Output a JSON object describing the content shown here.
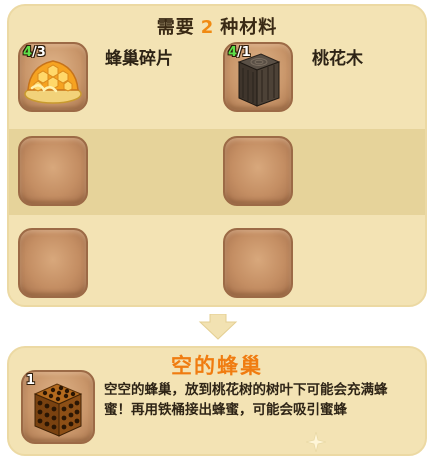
{
  "requirement": {
    "prefix": "需要",
    "count": "2",
    "suffix": "种材料"
  },
  "materials": [
    {
      "name": "蜂巢碎片",
      "have": "4",
      "need": "/3",
      "icon": "honeycomb-piece-icon"
    },
    {
      "name": "桃花木",
      "have": "4",
      "need": "/1",
      "icon": "peach-wood-log-icon"
    }
  ],
  "result": {
    "name": "空的蜂巢",
    "quantity": "1",
    "icon": "empty-beehive-icon",
    "description": "空空的蜂巢，放到桃花树的树叶下可能会充满蜂蜜！再用铁桶接出蜂蜜，可能会吸引蜜蜂"
  },
  "colors": {
    "panel": "#f3e3b4",
    "band": "#e6d39a",
    "accent": "#f08a12",
    "have_count": "#5fe04a"
  }
}
